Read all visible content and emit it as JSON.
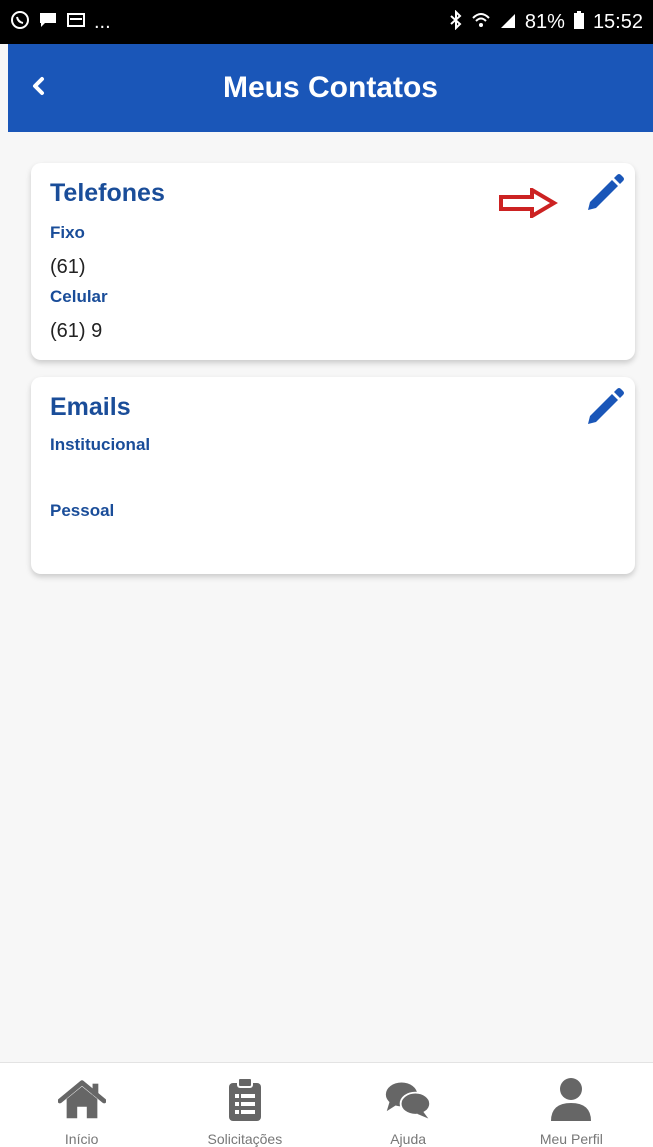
{
  "status_bar": {
    "left_icons": [
      "whatsapp-icon",
      "chat-icon",
      "tv-icon"
    ],
    "left_more": "...",
    "battery": "81%",
    "time": "15:52"
  },
  "header": {
    "title": "Meus Contatos",
    "back_icon": "chevron-left-icon",
    "color": "#1a56b8"
  },
  "telefones": {
    "title": "Telefones",
    "fields": [
      {
        "label": "Fixo",
        "value": "(61)"
      },
      {
        "label": "Celular",
        "value": "(61) 9"
      }
    ],
    "edit_icon": "pencil-icon",
    "annotation_icon": "red-arrow-icon"
  },
  "emails": {
    "title": "Emails",
    "fields": [
      {
        "label": "Institucional",
        "value": ""
      },
      {
        "label": "Pessoal",
        "value": ""
      }
    ],
    "edit_icon": "pencil-icon"
  },
  "bottom_nav": {
    "items": [
      {
        "label": "Início",
        "icon": "home-icon"
      },
      {
        "label": "Solicitações",
        "icon": "clipboard-icon"
      },
      {
        "label": "Ajuda",
        "icon": "chat-bubbles-icon"
      },
      {
        "label": "Meu Perfil",
        "icon": "user-icon"
      }
    ]
  },
  "colors": {
    "accent": "#1a56b8",
    "label": "#1a4d99",
    "annotation": "#cc2222"
  }
}
